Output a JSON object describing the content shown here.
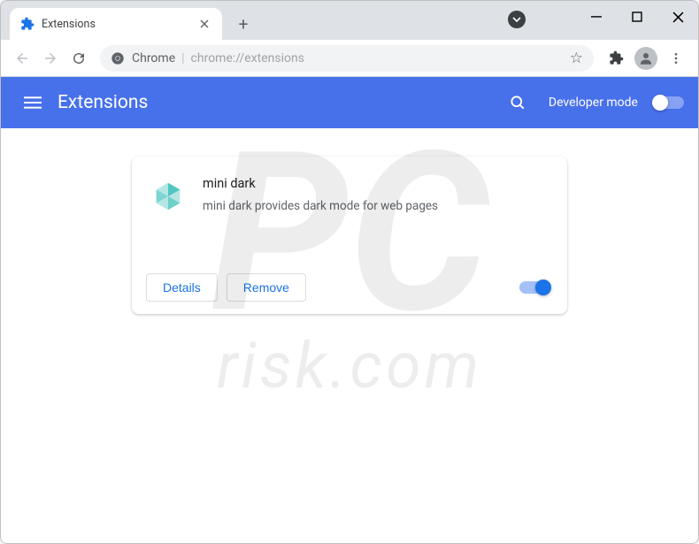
{
  "window": {
    "tab_title": "Extensions",
    "url_scheme_label": "Chrome",
    "url_path": "chrome://extensions"
  },
  "header": {
    "title": "Extensions",
    "dev_mode_label": "Developer mode",
    "dev_mode_enabled": false
  },
  "extension": {
    "name": "mini dark",
    "description": "mini dark provides dark mode for web pages",
    "details_label": "Details",
    "remove_label": "Remove",
    "enabled": true
  },
  "watermark": {
    "logo_text": "PC",
    "subtext": "risk.com"
  }
}
